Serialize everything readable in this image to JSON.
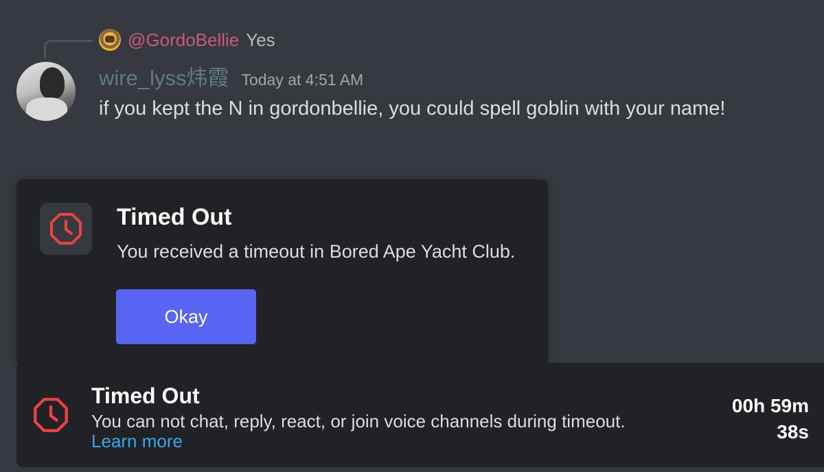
{
  "reply": {
    "mention": "@GordoBellie",
    "text": "Yes"
  },
  "message": {
    "username": "wire_lyss炜霞",
    "timestamp": "Today at 4:51 AM",
    "content": "if you kept the N in gordonbellie, you could spell goblin with your name!"
  },
  "modal": {
    "icon": "timeout-clock-octagon-icon",
    "title": "Timed Out",
    "description": "You received a timeout in Bored Ape Yacht Club.",
    "button_label": "Okay"
  },
  "timeout_bar": {
    "icon": "timeout-clock-octagon-icon",
    "title": "Timed Out",
    "description": "You can not chat, reply, react, or join voice channels during timeout.",
    "link_text": "Learn more",
    "timer_line1": "00h 59m",
    "timer_line2": "38s"
  },
  "colors": {
    "background": "#36393f",
    "card": "#202225",
    "accent_button": "#5865f2",
    "icon_red": "#ed4245",
    "link": "#3aa5f0",
    "mention": "#c85a7a",
    "username": "#5f7b86"
  }
}
